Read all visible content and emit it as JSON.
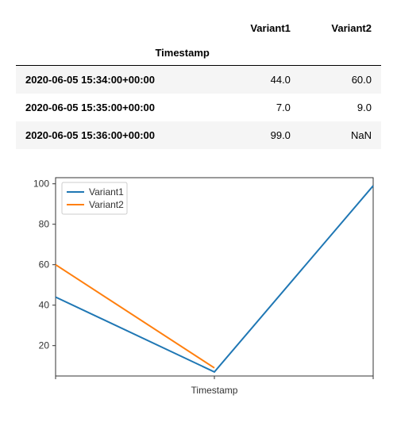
{
  "table": {
    "index_name": "Timestamp",
    "columns": [
      "Variant1",
      "Variant2"
    ],
    "rows": [
      {
        "ts": "2020-06-05 15:34:00+00:00",
        "v1": "44.0",
        "v2": "60.0"
      },
      {
        "ts": "2020-06-05 15:35:00+00:00",
        "v1": "7.0",
        "v2": "9.0"
      },
      {
        "ts": "2020-06-05 15:36:00+00:00",
        "v1": "99.0",
        "v2": "NaN"
      }
    ]
  },
  "chart_data": {
    "type": "line",
    "x": [
      "2020-06-05 15:34:00+00:00",
      "2020-06-05 15:35:00+00:00",
      "2020-06-05 15:36:00+00:00"
    ],
    "series": [
      {
        "name": "Variant1",
        "values": [
          44.0,
          7.0,
          99.0
        ],
        "color": "#1f77b4"
      },
      {
        "name": "Variant2",
        "values": [
          60.0,
          9.0,
          null
        ],
        "color": "#ff7f0e"
      }
    ],
    "xlabel": "Timestamp",
    "ylabel": "",
    "yticks": [
      20,
      40,
      60,
      80,
      100
    ],
    "ylim": [
      5,
      103
    ],
    "legend_position": "upper-left"
  },
  "colors": {
    "series1": "#1f77b4",
    "series2": "#ff7f0e",
    "axis": "#333333",
    "grid_bg": "#ffffff"
  }
}
